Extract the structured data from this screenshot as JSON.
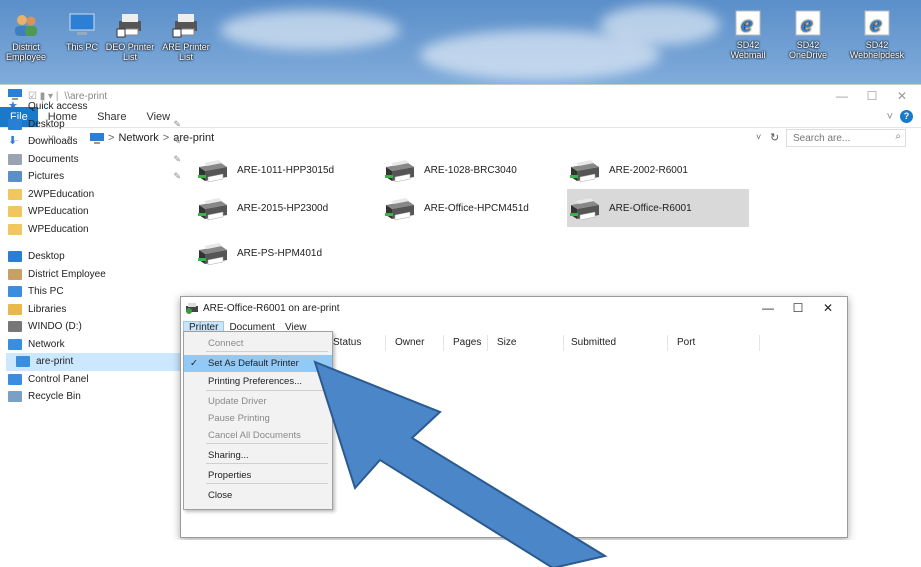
{
  "desktop": {
    "icons_left": [
      {
        "label_lines": [
          "District",
          "Employee"
        ],
        "icon": "users-icon"
      },
      {
        "label_lines": [
          "This PC"
        ],
        "icon": "computer-icon"
      },
      {
        "label_lines": [
          "DEO Printer",
          "List"
        ],
        "icon": "printer-shortcut-icon"
      },
      {
        "label_lines": [
          "ARE Printer",
          "List"
        ],
        "icon": "printer-shortcut-icon"
      }
    ],
    "icons_right": [
      {
        "label_lines": [
          "SD42",
          "Webmail"
        ],
        "icon": "ie-icon"
      },
      {
        "label_lines": [
          "SD42",
          "OneDrive"
        ],
        "icon": "ie-icon"
      },
      {
        "label_lines": [
          "SD42",
          "Webhelpdesk"
        ],
        "icon": "ie-icon"
      }
    ]
  },
  "explorer": {
    "title_path": "\\\\are-print",
    "ribbon": {
      "file": "File",
      "tabs": [
        "Home",
        "Share",
        "View"
      ],
      "help": "?"
    },
    "address": {
      "segments": [
        "Network",
        "are-print"
      ],
      "separator": ">",
      "search_placeholder": "Search are..."
    },
    "sidebar": [
      {
        "label": "Quick access",
        "icon": "star-icon",
        "pinned": false,
        "indent": 0,
        "color": "#2a7fd4"
      },
      {
        "label": "Desktop",
        "icon": "desktop-folder-icon",
        "pinned": true,
        "indent": 1,
        "color": "#2a7fd4"
      },
      {
        "label": "Downloads",
        "icon": "download-icon",
        "pinned": true,
        "indent": 1,
        "color": "#2a7fd4"
      },
      {
        "label": "Documents",
        "icon": "documents-icon",
        "pinned": true,
        "indent": 1,
        "color": "#9aa4b0"
      },
      {
        "label": "Pictures",
        "icon": "pictures-icon",
        "pinned": true,
        "indent": 1,
        "color": "#5b8fc7"
      },
      {
        "label": "2WPEducation",
        "icon": "folder-icon",
        "pinned": false,
        "indent": 1,
        "color": "#f0c75e"
      },
      {
        "label": "WPEducation",
        "icon": "folder-icon",
        "pinned": false,
        "indent": 1,
        "color": "#f0c75e"
      },
      {
        "label": "WPEducation",
        "icon": "folder-icon",
        "pinned": false,
        "indent": 1,
        "color": "#f0c75e"
      },
      {
        "label": "",
        "icon": "",
        "pinned": false,
        "indent": 0,
        "color": ""
      },
      {
        "label": "Desktop",
        "icon": "desktop-folder-icon",
        "pinned": false,
        "indent": 0,
        "color": "#2a7fd4"
      },
      {
        "label": "District Employee",
        "icon": "users-icon",
        "pinned": false,
        "indent": 1,
        "color": "#c9a064"
      },
      {
        "label": "This PC",
        "icon": "computer-icon",
        "pinned": false,
        "indent": 1,
        "color": "#3a8ee0"
      },
      {
        "label": "Libraries",
        "icon": "libraries-icon",
        "pinned": false,
        "indent": 1,
        "color": "#e8b84a"
      },
      {
        "label": "WINDO (D:)",
        "icon": "drive-icon",
        "pinned": false,
        "indent": 1,
        "color": "#777777"
      },
      {
        "label": "Network",
        "icon": "network-icon",
        "pinned": false,
        "indent": 1,
        "color": "#3a8ee0"
      },
      {
        "label": "are-print",
        "icon": "computer-icon",
        "pinned": false,
        "indent": 2,
        "color": "#3a8ee0",
        "selected": true
      },
      {
        "label": "Control Panel",
        "icon": "control-panel-icon",
        "pinned": false,
        "indent": 1,
        "color": "#3a8ee0"
      },
      {
        "label": "Recycle Bin",
        "icon": "recycle-bin-icon",
        "pinned": false,
        "indent": 1,
        "color": "#7aa0c8"
      }
    ],
    "printers": [
      {
        "name": "ARE-1011-HPP3015d",
        "selected": false
      },
      {
        "name": "ARE-1028-BRC3040",
        "selected": false
      },
      {
        "name": "ARE-2002-R6001",
        "selected": false
      },
      {
        "name": "ARE-2015-HP2300d",
        "selected": false
      },
      {
        "name": "ARE-Office-HPCM451d",
        "selected": false
      },
      {
        "name": "ARE-Office-R6001",
        "selected": true
      },
      {
        "name": "ARE-PS-HPM401d",
        "selected": false
      }
    ]
  },
  "queue_dialog": {
    "title": "ARE-Office-R6001 on are-print",
    "menu": [
      "Printer",
      "Document",
      "View"
    ],
    "columns": [
      "Status",
      "Owner",
      "Pages",
      "Size",
      "Submitted",
      "Port"
    ],
    "printer_menu": [
      {
        "label": "Connect",
        "enabled": false,
        "checked": false,
        "highlighted": false
      },
      {
        "label": "Set As Default Printer",
        "enabled": true,
        "checked": true,
        "highlighted": true
      },
      {
        "label": "Printing Preferences...",
        "enabled": true,
        "checked": false,
        "highlighted": false
      },
      {
        "label": "Update Driver",
        "enabled": false,
        "checked": false,
        "highlighted": false
      },
      {
        "label": "Pause Printing",
        "enabled": false,
        "checked": false,
        "highlighted": false
      },
      {
        "label": "Cancel All Documents",
        "enabled": false,
        "checked": false,
        "highlighted": false
      },
      {
        "label": "Sharing...",
        "enabled": true,
        "checked": false,
        "highlighted": false
      },
      {
        "label": "Properties",
        "enabled": true,
        "checked": false,
        "highlighted": false
      },
      {
        "label": "Close",
        "enabled": true,
        "checked": false,
        "highlighted": false
      }
    ]
  },
  "annotation": {
    "arrow_color": "#4a86c8",
    "arrow_outline": "#2b5a8f"
  }
}
